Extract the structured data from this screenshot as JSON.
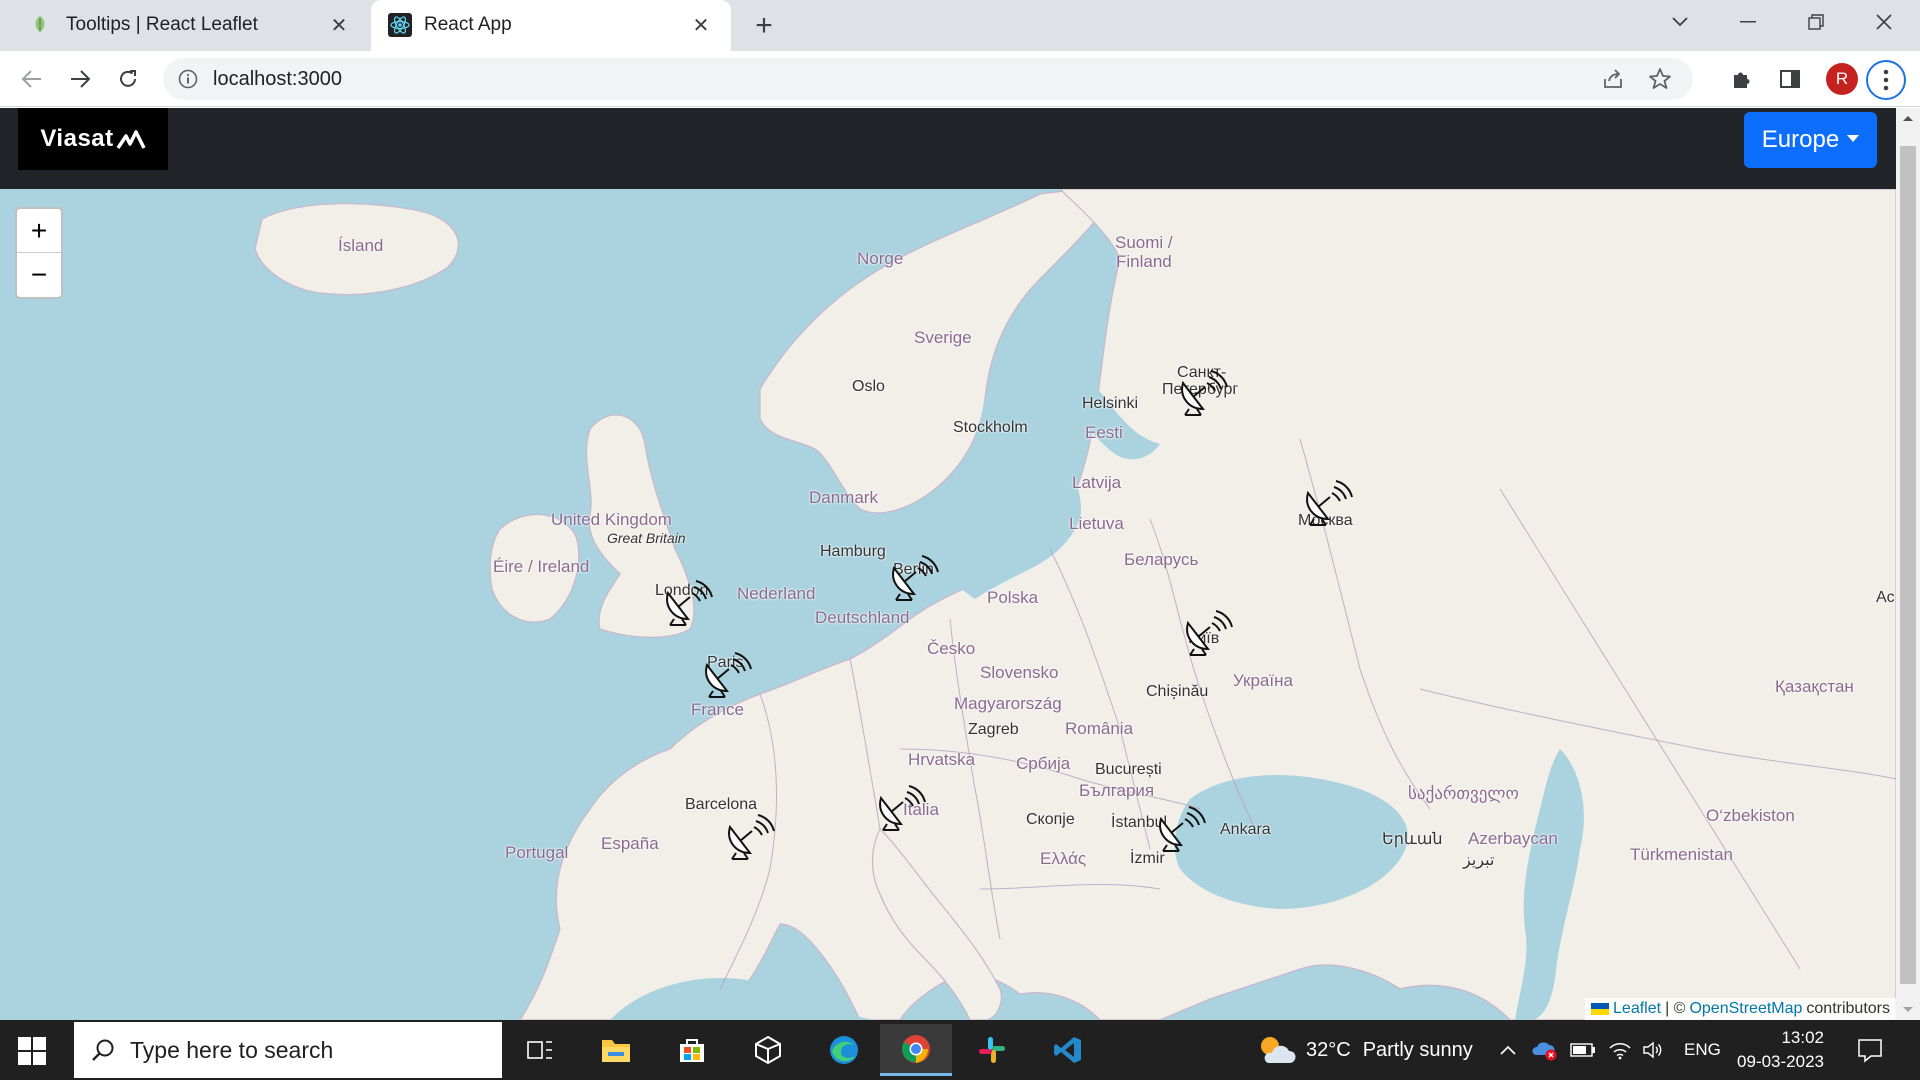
{
  "browser": {
    "tabs": [
      {
        "title": "Tooltips | React Leaflet",
        "icon": "leaf-icon",
        "active": false
      },
      {
        "title": "React App",
        "icon": "react-icon",
        "active": true
      }
    ],
    "url": "localhost:3000",
    "profile_initial": "R"
  },
  "app": {
    "logo": "Viasat",
    "region_button": "Europe"
  },
  "map": {
    "zoom_in": "+",
    "zoom_out": "−",
    "labels": {
      "island": "Ísland",
      "norge": "Norge",
      "suomi": "Suomi /",
      "finland": "Finland",
      "sverige": "Sverige",
      "oslo": "Oslo",
      "stockholm": "Stockholm",
      "helsinki": "Helsinki",
      "spb1": "Санкт-",
      "spb2": "Петербург",
      "eesti": "Eesti",
      "latvija": "Latvija",
      "danmark": "Danmark",
      "lietuva": "Lietuva",
      "moskva": "Москва",
      "uk": "United Kingdom",
      "gb": "Great Britain",
      "ireland": "Éire / Ireland",
      "hamburg": "Hamburg",
      "berlin": "Berlin",
      "belarus": "Беларусь",
      "london": "London",
      "nederland": "Nederland",
      "polska": "Polska",
      "deutschland": "Deutschland",
      "kyiv": "Київ",
      "paris": "Paris",
      "cesko": "Česko",
      "slovensko": "Slovensko",
      "ukraina": "Україна",
      "france": "France",
      "chisinau": "Chișinău",
      "kazakhstan": "Қазақстан",
      "magyar": "Magyarország",
      "zagreb": "Zagreb",
      "romania": "România",
      "hrvatska": "Hrvatska",
      "srbija": "Србија",
      "bucuresti": "București",
      "bulgaria": "България",
      "barcelona": "Barcelona",
      "italia": "Italia",
      "skopje": "Скопје",
      "istanbul": "İstanbul",
      "ankara": "Ankara",
      "georgia": "საქართველო",
      "uzbekiston": "O‘zbekiston",
      "portugal": "Portugal",
      "espana": "España",
      "ellas": "Ελλάς",
      "izmir": "İzmir",
      "yerevan": "Երևան",
      "azerbaycan": "Azerbaycan",
      "tabriz": "تبریز",
      "ac": "Ac",
      "turkmenistan": "Türkmenistan"
    },
    "attribution": {
      "leaflet": "Leaflet",
      "separator": "| ©",
      "osm": "OpenStreetMap",
      "suffix": "contributors"
    }
  },
  "taskbar": {
    "search_placeholder": "Type here to search",
    "weather_temp": "32°C",
    "weather_text": "Partly sunny",
    "language": "ENG",
    "time": "13:02",
    "date": "09-03-2023"
  }
}
